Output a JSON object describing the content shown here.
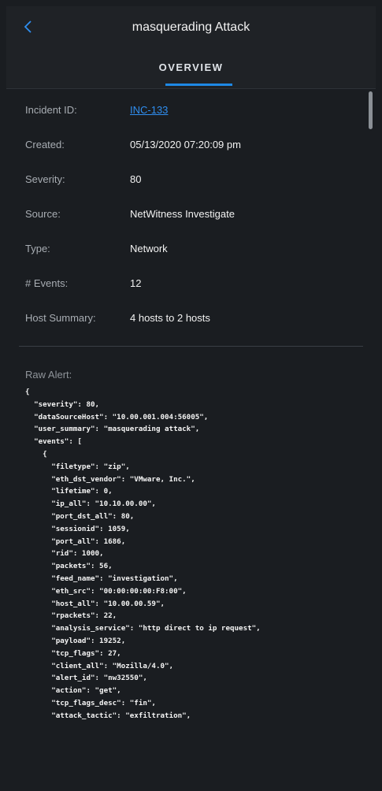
{
  "header": {
    "title": "masquerading Attack",
    "back_icon": "chevron-left-icon"
  },
  "tabs": [
    {
      "label": "OVERVIEW",
      "active": true
    }
  ],
  "fields": [
    {
      "label": "Incident ID:",
      "value": "INC-133",
      "link": true
    },
    {
      "label": "Created:",
      "value": "05/13/2020 07:20:09 pm"
    },
    {
      "label": "Severity:",
      "value": "80"
    },
    {
      "label": "Source:",
      "value": "NetWitness Investigate"
    },
    {
      "label": "Type:",
      "value": "Network"
    },
    {
      "label": "# Events:",
      "value": "12"
    },
    {
      "label": "Host Summary:",
      "value": "4 hosts to 2 hosts"
    }
  ],
  "raw_alert": {
    "label": "Raw Alert:",
    "text": "{\n  \"severity\": 80,\n  \"dataSourceHost\": \"10.00.001.004:56005\",\n  \"user_summary\": \"masquerading attack\",\n  \"events\": [\n    {\n      \"filetype\": \"zip\",\n      \"eth_dst_vendor\": \"VMware, Inc.\",\n      \"lifetime\": 0,\n      \"ip_all\": \"10.10.00.00\",\n      \"port_dst_all\": 80,\n      \"sessionid\": 1059,\n      \"port_all\": 1686,\n      \"rid\": 1000,\n      \"packets\": 56,\n      \"feed_name\": \"investigation\",\n      \"eth_src\": \"00:00:00:00:F8:00\",\n      \"host_all\": \"10.00.00.59\",\n      \"rpackets\": 22,\n      \"analysis_service\": \"http direct to ip request\",\n      \"payload\": 19252,\n      \"tcp_flags\": 27,\n      \"client_all\": \"Mozilla/4.0\",\n      \"alert_id\": \"nw32550\",\n      \"action\": \"get\",\n      \"tcp_flags_desc\": \"fin\",\n      \"attack_tactic\": \"exfiltration\","
  },
  "colors": {
    "accent": "#1e88e5",
    "link": "#2f8ef0",
    "background": "#1a1d21"
  }
}
